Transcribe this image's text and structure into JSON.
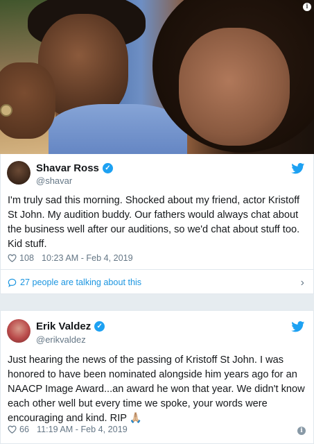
{
  "hero": {
    "info_glyph": "i"
  },
  "tweets": [
    {
      "name": "Shavar Ross",
      "handle": "@shavar",
      "text": "I'm truly sad this morning. Shocked about my friend, actor Kristoff St John. My audition buddy. Our fathers would always chat about the business well after our auditions, so we'd chat about stuff too. Kid stuff.",
      "likes": "108",
      "timestamp": "10:23 AM - Feb 4, 2019",
      "talking": "27 people are talking about this"
    },
    {
      "name": "Erik Valdez",
      "handle": "@erikvaldez",
      "text": "Just hearing the news of the passing of Kristoff St John. I was honored to have been nominated alongside him years ago for an NAACP Image Award...an award he won that year. We didn't know each other well but every time we spoke, your words were encouraging and kind. RIP 🙏🏼",
      "likes": "66",
      "timestamp": "11:19 AM - Feb 4, 2019"
    }
  ],
  "icons": {
    "verified": "verified-badge-icon",
    "bird": "twitter-bird-icon",
    "heart": "heart-icon",
    "bubble": "speech-bubble-icon",
    "chevron": "chevron-right-icon",
    "info": "info-icon"
  },
  "colors": {
    "twitter_blue": "#1da1f2",
    "link_blue": "#1b95e0",
    "meta_gray": "#657786"
  }
}
